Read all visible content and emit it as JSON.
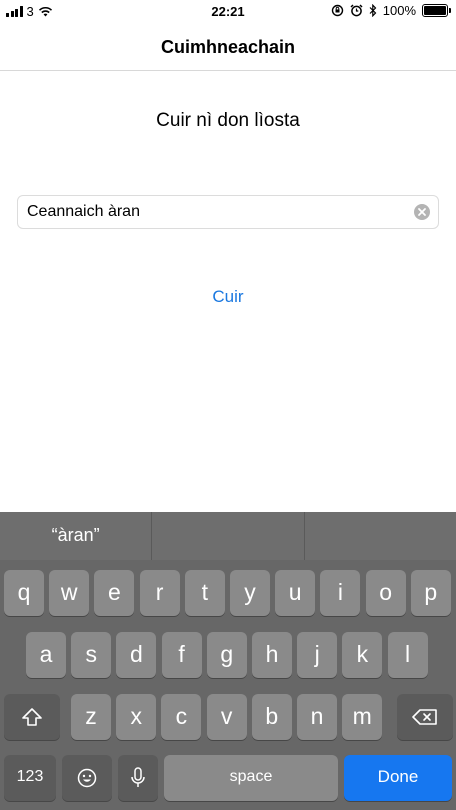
{
  "status_bar": {
    "signal": "3",
    "time": "22:21",
    "battery": "100%",
    "battery_level": 1.0
  },
  "nav": {
    "title": "Cuimhneachain"
  },
  "content": {
    "prompt": "Cuir nì don lìosta",
    "input_value": "Ceannaich àran",
    "add_label": "Cuir"
  },
  "keyboard": {
    "suggestions": [
      "“àran”",
      "",
      ""
    ],
    "row1": [
      "q",
      "w",
      "e",
      "r",
      "t",
      "y",
      "u",
      "i",
      "o",
      "p"
    ],
    "row2": [
      "a",
      "s",
      "d",
      "f",
      "g",
      "h",
      "j",
      "k",
      "l"
    ],
    "row3": [
      "z",
      "x",
      "c",
      "v",
      "b",
      "n",
      "m"
    ],
    "numbers_label": "123",
    "space_label": "space",
    "done_label": "Done"
  },
  "colors": {
    "accent": "#1a78e0",
    "done": "#1677f0",
    "keyboard_bg": "#676767",
    "key": "#8a8a8a"
  }
}
